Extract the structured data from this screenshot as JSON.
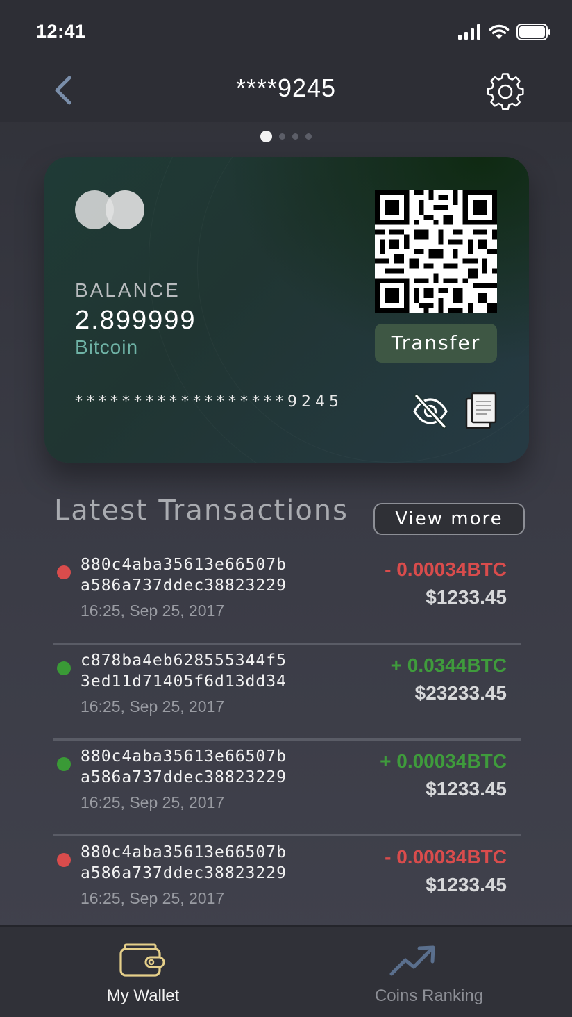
{
  "status_bar": {
    "time": "12:41"
  },
  "nav": {
    "title": "****9245",
    "back_icon": "chevron-left-icon",
    "settings_icon": "gear-icon"
  },
  "pager": {
    "count": 4,
    "active": 0
  },
  "card": {
    "balance_label": "BALANCE",
    "balance_value": "2.899999",
    "currency": "Bitcoin",
    "transfer_label": "Transfer",
    "card_number": "******************9245"
  },
  "transactions": {
    "title": "Latest Transactions",
    "view_more_label": "View more",
    "items": [
      {
        "hash_line1": "880c4aba35613e66507b",
        "hash_line2": "a586a737ddec38823229",
        "date": "16:25, Sep 25, 2017",
        "amount": "- 0.00034BTC",
        "usd": "$1233.45",
        "direction": "out"
      },
      {
        "hash_line1": "c878ba4eb628555344f5",
        "hash_line2": "3ed11d71405f6d13dd34",
        "date": "16:25, Sep 25, 2017",
        "amount": "+ 0.0344BTC",
        "usd": "$23233.45",
        "direction": "in"
      },
      {
        "hash_line1": "880c4aba35613e66507b",
        "hash_line2": "a586a737ddec38823229",
        "date": "16:25, Sep 25, 2017",
        "amount": "+ 0.00034BTC",
        "usd": "$1233.45",
        "direction": "in"
      },
      {
        "hash_line1": "880c4aba35613e66507b",
        "hash_line2": "a586a737ddec38823229",
        "date": "16:25, Sep 25, 2017",
        "amount": "- 0.00034BTC",
        "usd": "$1233.45",
        "direction": "out"
      }
    ]
  },
  "tabbar": {
    "wallet_label": "My Wallet",
    "ranking_label": "Coins Ranking"
  },
  "colors": {
    "negative": "#d94c4c",
    "positive": "#3f9b3c",
    "currency_accent": "#6fb3a6",
    "wallet_icon": "#e6d08a"
  }
}
